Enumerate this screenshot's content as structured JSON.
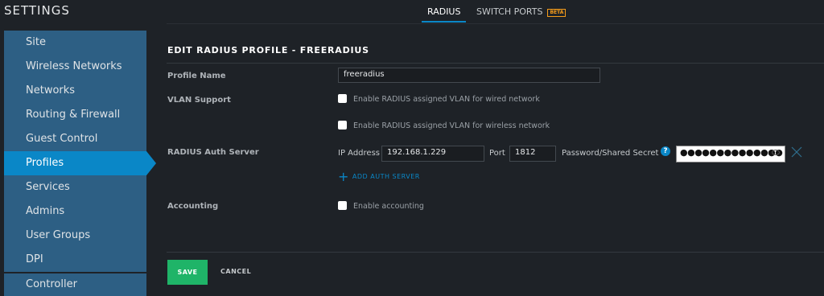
{
  "sidebar": {
    "title": "SETTINGS",
    "items": [
      {
        "label": "Site"
      },
      {
        "label": "Wireless Networks"
      },
      {
        "label": "Networks"
      },
      {
        "label": "Routing & Firewall"
      },
      {
        "label": "Guest Control"
      },
      {
        "label": "Profiles"
      },
      {
        "label": "Services"
      },
      {
        "label": "Admins"
      },
      {
        "label": "User Groups"
      },
      {
        "label": "DPI"
      },
      {
        "label": "Controller"
      }
    ],
    "active": "Profiles"
  },
  "tabs": {
    "radius": "RADIUS",
    "switch_ports": "SWITCH PORTS",
    "beta_badge": "BETA"
  },
  "form": {
    "heading": "EDIT RADIUS PROFILE - FREERADIUS",
    "profile_name_label": "Profile Name",
    "profile_name_value": "freeradius",
    "vlan_label": "VLAN Support",
    "vlan_wired": "Enable RADIUS assigned VLAN for wired network",
    "vlan_wireless": "Enable RADIUS assigned VLAN for wireless network",
    "auth_label": "RADIUS Auth Server",
    "ip_label": "IP Address",
    "ip_value": "192.168.1.229",
    "port_label": "Port",
    "port_value": "1812",
    "secret_label": "Password/Shared Secret",
    "secret_value": "●●●●●●●●●●●●●●",
    "help_symbol": "?",
    "add_auth": "ADD AUTH SERVER",
    "accounting_label": "Accounting",
    "accounting_option": "Enable accounting"
  },
  "actions": {
    "save": "SAVE",
    "cancel": "CANCEL"
  },
  "colors": {
    "accent": "#0a87c7",
    "save": "#1fb468",
    "beta": "#f59c1a"
  }
}
